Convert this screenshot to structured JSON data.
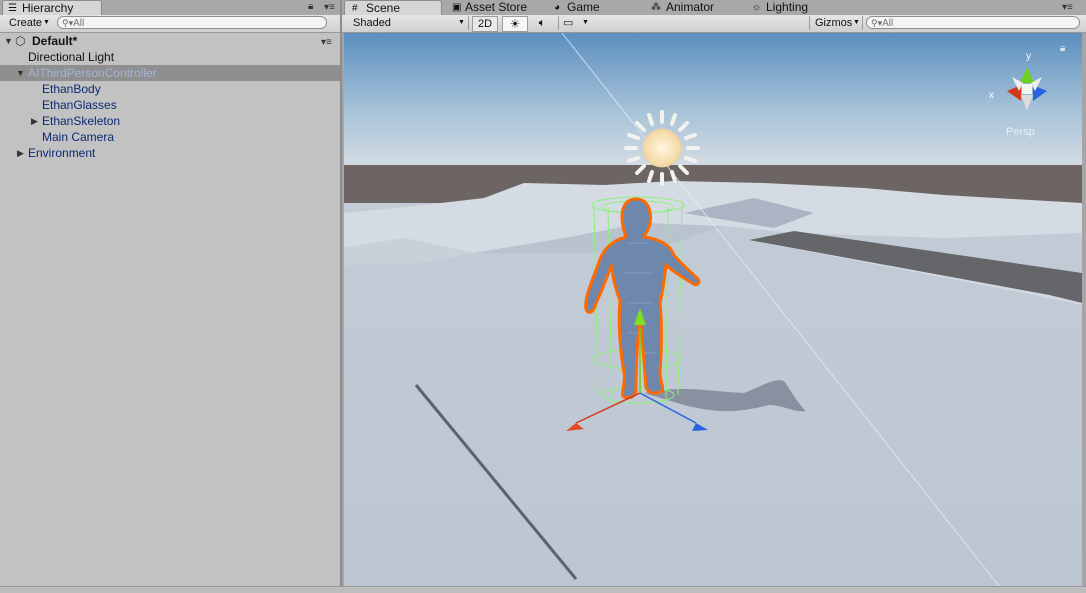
{
  "hierarchy": {
    "tab_label": "Hierarchy",
    "create_label": "Create",
    "search_placeholder": "All",
    "scene_name": "Default*",
    "items": [
      {
        "label": "Directional Light"
      },
      {
        "label": "AIThirdPersonController"
      },
      {
        "label": "EthanBody"
      },
      {
        "label": "EthanGlasses"
      },
      {
        "label": "EthanSkeleton"
      },
      {
        "label": "Main Camera"
      },
      {
        "label": "Environment"
      }
    ]
  },
  "tabs": {
    "scene": "Scene",
    "asset_store": "Asset Store",
    "game": "Game",
    "animator": "Animator",
    "lighting": "Lighting"
  },
  "scene_toolbar": {
    "shading_mode": "Shaded",
    "two_d": "2D",
    "gizmos": "Gizmos",
    "search_placeholder": "All"
  },
  "gizmo": {
    "y_label": "y",
    "x_label": "x",
    "projection": "Persp"
  },
  "colors": {
    "x_axis": "#d23a1e",
    "y_axis": "#6bd11a",
    "z_axis": "#2a62e0",
    "selection_outline": "#ff6a00",
    "collider": "#8ef07a"
  }
}
